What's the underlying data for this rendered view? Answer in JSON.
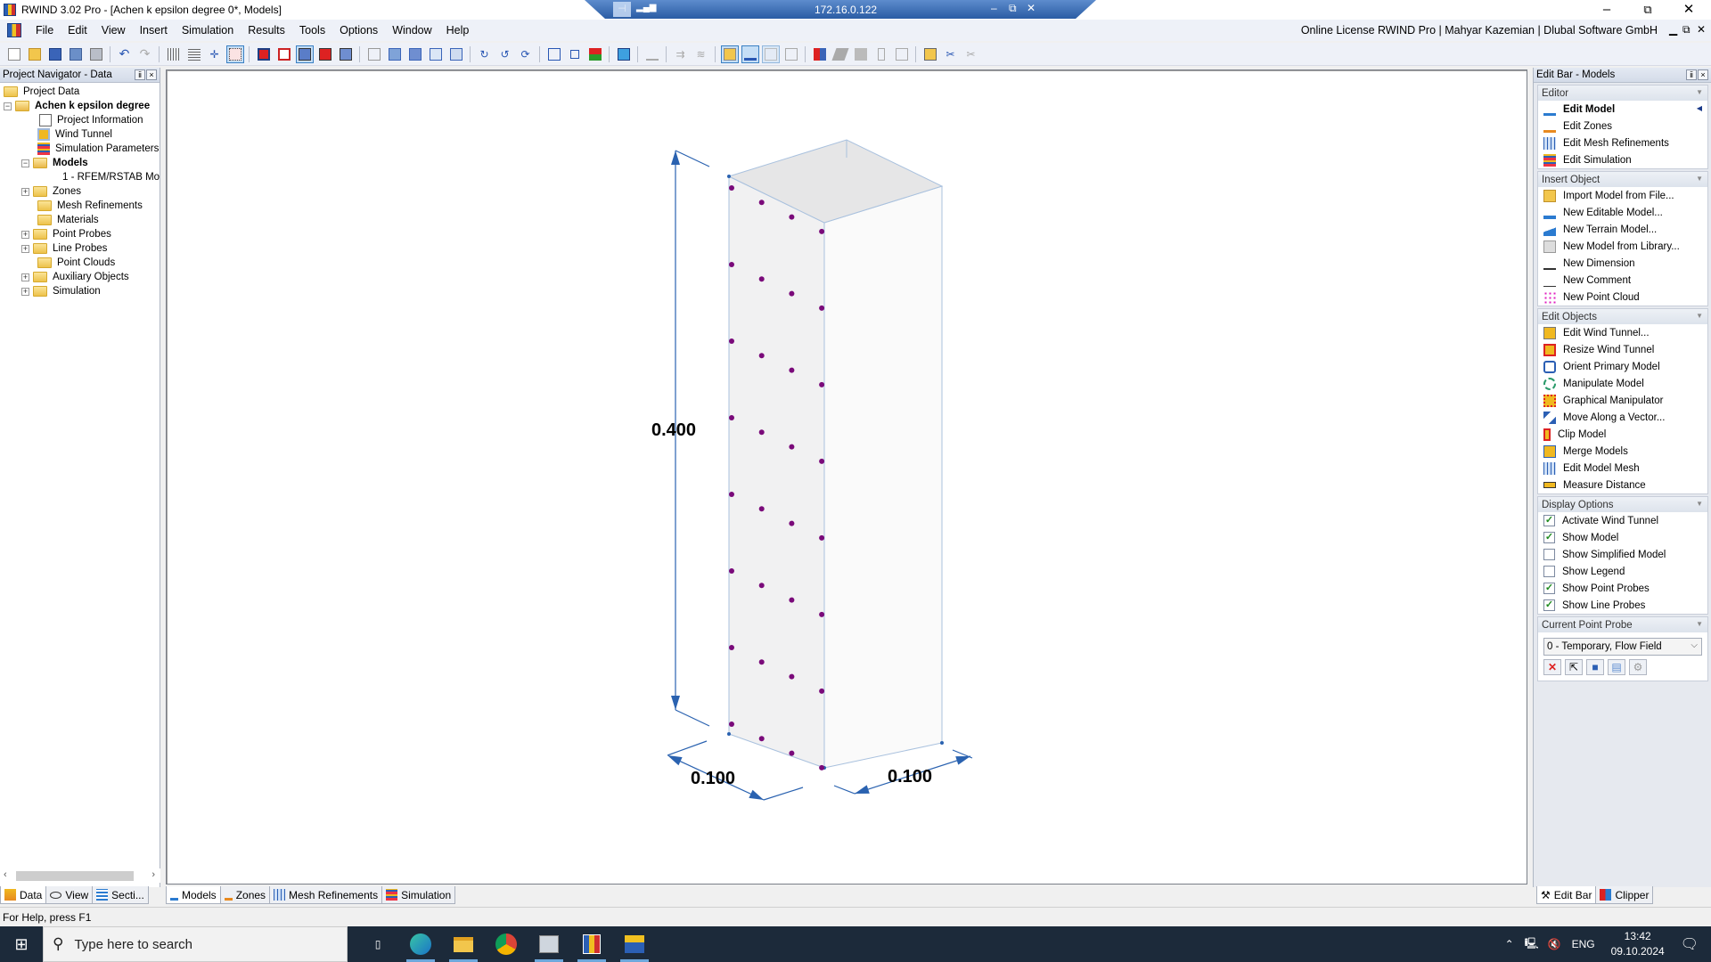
{
  "window": {
    "title": "RWIND 3.02 Pro - [Achen  k epsilon degree 0*, Models]",
    "license": "Online License RWIND Pro | Mahyar Kazemian | Dlubal Software GmbH"
  },
  "remote_bar": {
    "ip": "172.16.0.122"
  },
  "menu": [
    "File",
    "Edit",
    "View",
    "Insert",
    "Simulation",
    "Results",
    "Tools",
    "Options",
    "Window",
    "Help"
  ],
  "navigator": {
    "title": "Project Navigator - Data",
    "root": "Project Data",
    "project": "Achen  k epsilon degree",
    "items": [
      {
        "label": "Project Information",
        "level": 2,
        "icon": "project-info-icon"
      },
      {
        "label": "Wind Tunnel",
        "level": 2,
        "icon": "wind-tunnel-icon"
      },
      {
        "label": "Simulation Parameters",
        "level": 2,
        "icon": "simulation-params-icon"
      },
      {
        "label": "Models",
        "level": 2,
        "icon": "folder-icon",
        "bold": true,
        "expanded": true
      },
      {
        "label": "1 - RFEM/RSTAB Mo",
        "level": 3,
        "icon": "model-icon"
      },
      {
        "label": "Zones",
        "level": 2,
        "icon": "folder-icon",
        "expandable": true
      },
      {
        "label": "Mesh Refinements",
        "level": 2,
        "icon": "folder-icon"
      },
      {
        "label": "Materials",
        "level": 2,
        "icon": "folder-icon"
      },
      {
        "label": "Point Probes",
        "level": 2,
        "icon": "folder-icon",
        "expandable": true
      },
      {
        "label": "Line Probes",
        "level": 2,
        "icon": "folder-icon",
        "expandable": true
      },
      {
        "label": "Point Clouds",
        "level": 2,
        "icon": "folder-icon"
      },
      {
        "label": "Auxiliary Objects",
        "level": 2,
        "icon": "folder-icon",
        "expandable": true
      },
      {
        "label": "Simulation",
        "level": 2,
        "icon": "folder-icon",
        "expandable": true
      }
    ],
    "tabs": [
      "Data",
      "View",
      "Secti..."
    ]
  },
  "view_tabs": [
    "Models",
    "Zones",
    "Mesh Refinements",
    "Simulation"
  ],
  "viewport": {
    "dimensions": {
      "height": "0.400",
      "width_left": "0.100",
      "width_right": "0.100"
    },
    "probe_color": "#7a0a7a",
    "probe_rows": 8,
    "probe_columns": 4
  },
  "editbar": {
    "title": "Edit Bar - Models",
    "sections": {
      "editor": {
        "title": "Editor",
        "items": [
          "Edit Model",
          "Edit Zones",
          "Edit Mesh Refinements",
          "Edit Simulation"
        ]
      },
      "insert": {
        "title": "Insert Object",
        "items": [
          "Import Model from File...",
          "New Editable Model...",
          "New Terrain Model...",
          "New Model from Library...",
          "New Dimension",
          "New Comment",
          "New Point Cloud"
        ]
      },
      "edit_objects": {
        "title": "Edit Objects",
        "items": [
          "Edit Wind Tunnel...",
          "Resize Wind Tunnel",
          "Orient Primary Model",
          "Manipulate Model",
          "Graphical Manipulator",
          "Move Along a Vector...",
          "Clip Model",
          "Merge Models",
          "Edit Model Mesh",
          "Measure Distance"
        ]
      },
      "display": {
        "title": "Display Options",
        "items": [
          {
            "label": "Activate Wind Tunnel",
            "checked": true
          },
          {
            "label": "Show Model",
            "checked": true
          },
          {
            "label": "Show Simplified Model",
            "checked": false
          },
          {
            "label": "Show Legend",
            "checked": false
          },
          {
            "label": "Show Point Probes",
            "checked": true
          },
          {
            "label": "Show Line Probes",
            "checked": true
          }
        ]
      },
      "probe": {
        "title": "Current Point Probe",
        "selected": "0 - Temporary, Flow Field"
      }
    },
    "tabs": [
      "Edit Bar",
      "Clipper"
    ]
  },
  "status": "For Help, press F1",
  "taskbar": {
    "search_placeholder": "Type here to search",
    "lang": "ENG",
    "time": "13:42",
    "date": "09.10.2024"
  }
}
